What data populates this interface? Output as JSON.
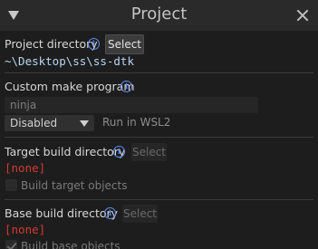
{
  "window": {
    "title": "Project"
  },
  "project_directory": {
    "label": "Project directory",
    "select_label": "Select",
    "path": "~\\Desktop\\ss\\ss-dtk"
  },
  "custom_make": {
    "label": "Custom make program",
    "input_placeholder": "ninja",
    "wsl_select_value": "Disabled",
    "wsl_label": "Run in WSL2"
  },
  "target_build": {
    "label": "Target build directory",
    "select_label": "Select",
    "value": "[none]",
    "checkbox_label": "Build target objects",
    "checked": false
  },
  "base_build": {
    "label": "Base build directory",
    "select_label": "Select",
    "value": "[none]",
    "checkbox_label": "Build base objects",
    "checked": true
  },
  "colors": {
    "path": "#b6d6f4",
    "none": "#d33a32",
    "info": "#5b8ff0"
  }
}
